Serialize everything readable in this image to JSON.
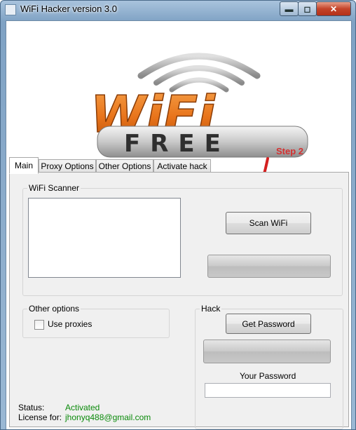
{
  "window": {
    "title": "WiFi  Hacker version 3.0",
    "controls": {
      "minimize": "▬",
      "maximize": "◻",
      "close": "✕"
    }
  },
  "annotation": {
    "step_label": "Step 2"
  },
  "tabs": [
    {
      "label": "Main",
      "active": true
    },
    {
      "label": "Proxy Options",
      "active": false
    },
    {
      "label": "Other Options",
      "active": false
    },
    {
      "label": "Activate hack",
      "active": false
    }
  ],
  "scanner": {
    "group_label": "WiFi Scanner",
    "scan_button": "Scan WiFi"
  },
  "other_options": {
    "group_label": "Other options",
    "use_proxies_label": "Use proxies",
    "use_proxies_checked": false
  },
  "hack": {
    "group_label": "Hack",
    "get_password_button": "Get Password",
    "your_password_label": "Your Password",
    "password_value": ""
  },
  "status": {
    "status_label": "Status:",
    "status_value": "Activated",
    "license_label": "License for:",
    "license_value": "jhonyq488@gmail.com"
  },
  "colors": {
    "status_green": "#0a8a0a",
    "step_red": "#d43030",
    "logo_orange": "#e8731a"
  }
}
